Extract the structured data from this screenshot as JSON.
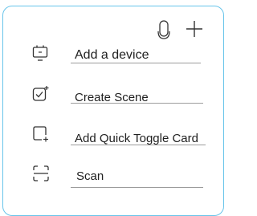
{
  "header": {
    "icons": [
      "microphone-icon",
      "plus-icon"
    ]
  },
  "menu": {
    "items": [
      {
        "label": "Add a device",
        "icon": "device-add-icon"
      },
      {
        "label": "Create Scene",
        "icon": "scene-create-icon"
      },
      {
        "label": "Add Quick Toggle Card",
        "icon": "quick-toggle-card-icon"
      },
      {
        "label": "Scan",
        "icon": "scan-icon"
      }
    ]
  },
  "colors": {
    "panel_border": "#67c4ea",
    "text": "#202020",
    "divider": "#9c9c9c",
    "icon": "#333333"
  }
}
